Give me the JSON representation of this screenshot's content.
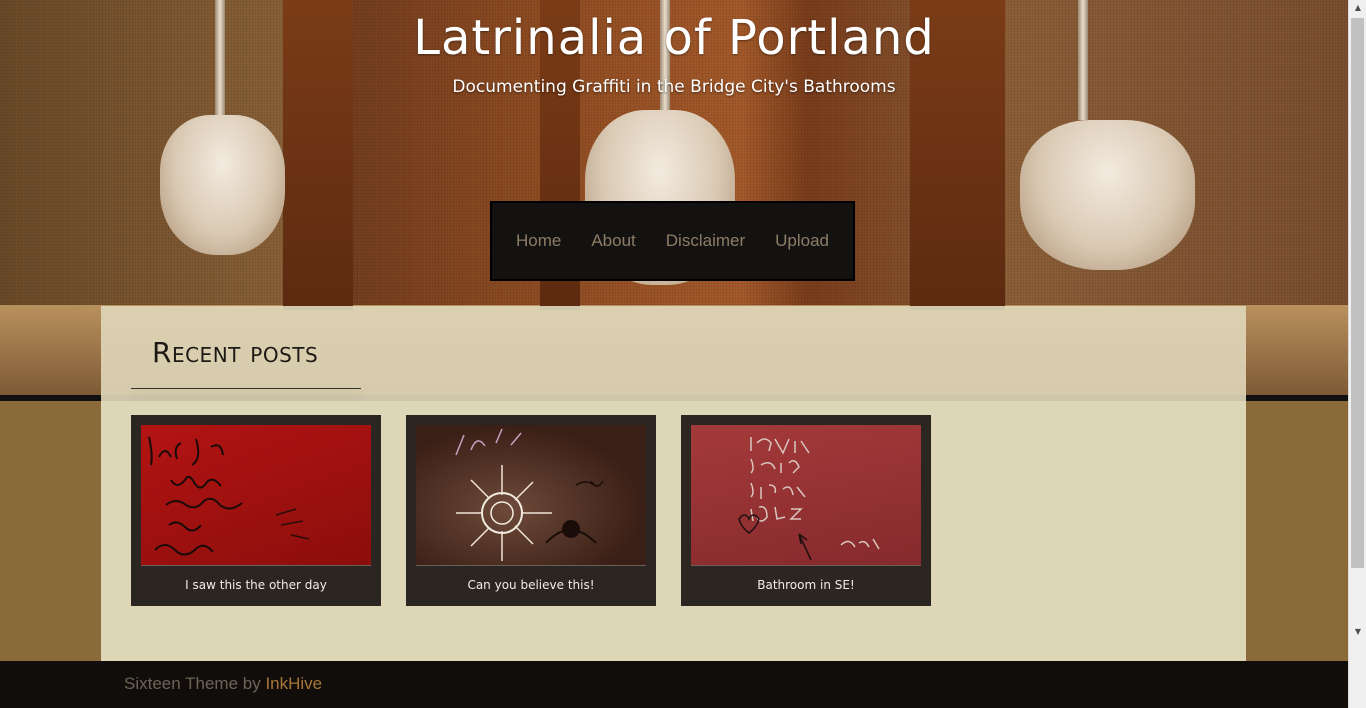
{
  "site": {
    "title": "Latrinalia of Portland",
    "description": "Documenting Graffiti in the Bridge City's Bathrooms"
  },
  "nav": {
    "items": [
      "Home",
      "About",
      "Disclaimer",
      "Upload"
    ]
  },
  "recent": {
    "heading": "Recent posts",
    "posts": [
      {
        "caption": "I saw this the other day"
      },
      {
        "caption": "Can you believe this!"
      },
      {
        "caption": "Bathroom in SE!"
      }
    ]
  },
  "footer": {
    "prefix": "Sixteen Theme by ",
    "link": "InkHive"
  },
  "colors": {
    "page_bg": "#8b6a3a",
    "content_bg": "#ddd6b7",
    "card_bg": "#2c2622",
    "nav_bg": "#141210",
    "footer_bg": "#100d0b",
    "footer_link": "#a87738"
  }
}
